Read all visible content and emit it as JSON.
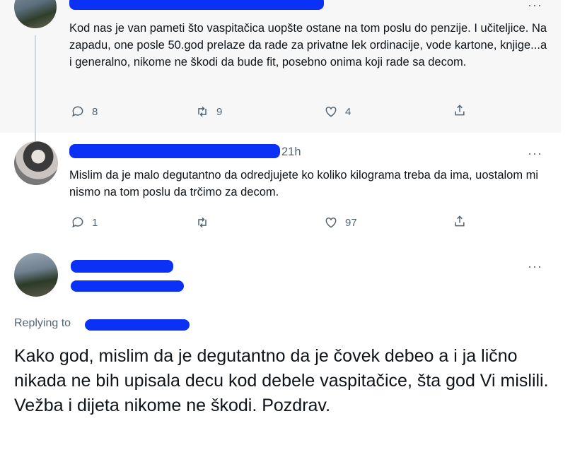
{
  "tweets": [
    {
      "body": "Kod nas je van pameti što vaspitačica uopšte ostane na tom poslu do penzije. I učiteljice. Na zapadu, one posle 50.god prelaze da rade za privatne lek ordinacije, vode kartone, knjige...a i generalno, nikome ne škodi da bude fit, posebno onima koji rade sa decom.",
      "more": "···",
      "replies": "8",
      "retweets": "9",
      "likes": "4"
    },
    {
      "time": "21h",
      "body": "Mislim da je malo degutantno da odredjujete ko koliko kilograma treba da ima, uostalom mi nismo na tom poslu da trčimo za decom.",
      "more": "···",
      "replies": "1",
      "retweets": "",
      "likes": "97"
    }
  ],
  "main_tweet": {
    "more": "···",
    "replying_label": "Replying to",
    "body": "Kako god, mislim da je degutantno da je čovek debeo a i ja lično nikada ne bih upisala decu kod debele vaspitačice, šta god Vi mislili. Vežba i dijeta nikome ne škodi. Pozdrav."
  },
  "icons": [
    "reply-icon",
    "retweet-icon",
    "like-icon",
    "share-icon",
    "more-icon"
  ],
  "colors": {
    "redaction": "#0a31f5",
    "muted_text": "#536471",
    "thread_line": "#cfd9de",
    "highlight_bg": "#f7f7f7"
  }
}
